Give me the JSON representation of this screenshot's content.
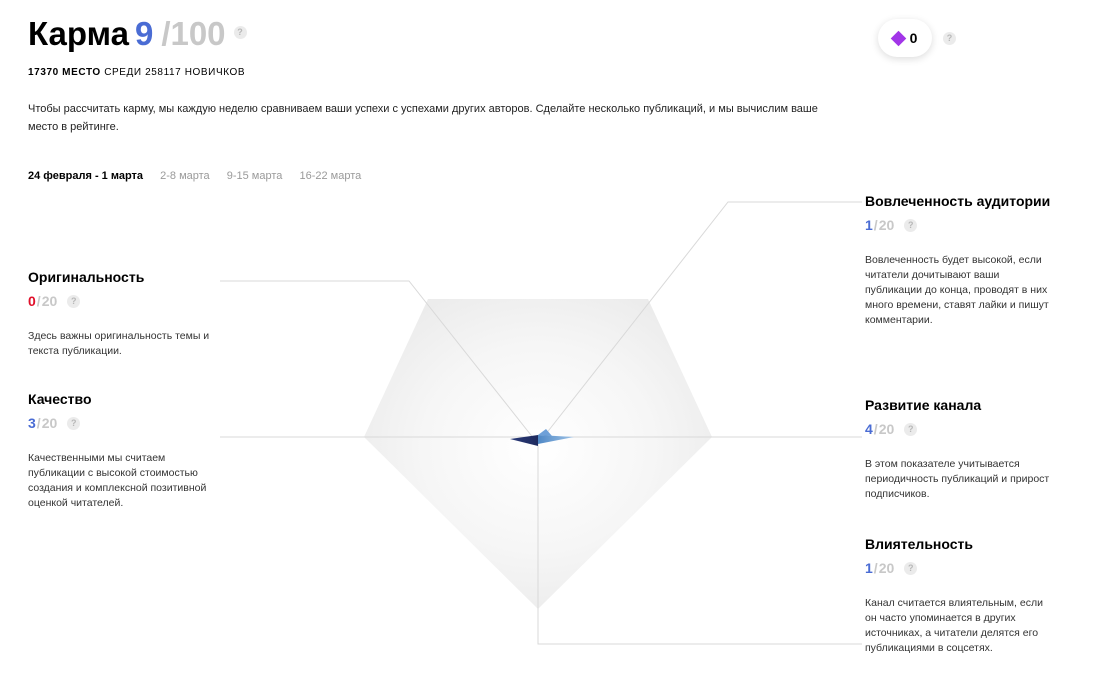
{
  "header": {
    "title": "Карма",
    "score": "9",
    "max": "/100",
    "help": "?"
  },
  "rank": {
    "place": "17370 место",
    "rest": "среди 258117 новичков"
  },
  "description": "Чтобы рассчитать карму, мы каждую неделю сравниваем ваши успехи с успехами других авторов. Сделайте несколько публикаций, и мы вычислим ваше место в рейтинге.",
  "tabs": [
    {
      "label": "24 февраля - 1 марта",
      "active": true
    },
    {
      "label": "2-8 марта",
      "active": false
    },
    {
      "label": "9-15 марта",
      "active": false
    },
    {
      "label": "16-22 марта",
      "active": false
    }
  ],
  "badge": {
    "value": "0",
    "help": "?",
    "icon": "diamond-icon",
    "color": "#a235e8"
  },
  "metrics": {
    "originality": {
      "title": "Оригинальность",
      "value": "0",
      "slash": "/",
      "max": "20",
      "help": "?",
      "desc": "Здесь важны оригинальность темы и текста публикации."
    },
    "quality": {
      "title": "Качество",
      "value": "3",
      "slash": "/",
      "max": "20",
      "help": "?",
      "desc": "Качественными мы считаем публикации с высокой стоимостью создания и комплексной позитивной оценкой читателей."
    },
    "engagement": {
      "title": "Вовлеченность аудитории",
      "value": "1",
      "slash": "/",
      "max": "20",
      "help": "?",
      "desc": "Вовлеченность будет высокой, если читатели дочитывают ваши публикации до конца, проводят в них много времени, ставят лайки и пишут комментарии."
    },
    "growth": {
      "title": "Развитие канала",
      "value": "4",
      "slash": "/",
      "max": "20",
      "help": "?",
      "desc": "В этом показателе учитывается периодичность публикаций и прирост подписчиков."
    },
    "influence": {
      "title": "Влиятельность",
      "value": "1",
      "slash": "/",
      "max": "20",
      "help": "?",
      "desc": "Канал считается влиятельным, если он часто упоминается в других источниках, а читатели делятся его публикациями в соцсетях."
    }
  },
  "colors": {
    "accent": "#4a6cd4",
    "zero": "#e0102a",
    "muted": "#c8c8c8"
  }
}
